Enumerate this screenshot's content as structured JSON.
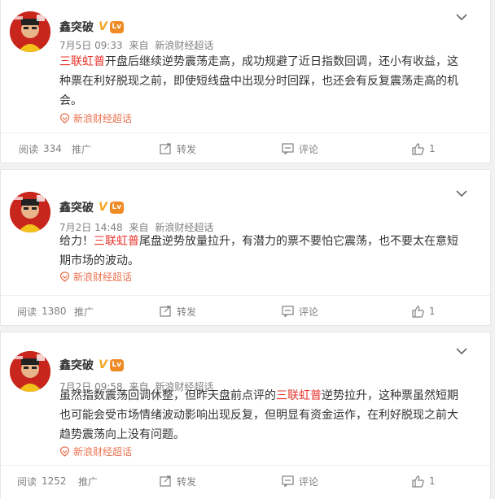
{
  "posts": [
    {
      "user": "鑫突破",
      "verified_badge": "V",
      "level_badge": "Lv",
      "time": "7月5日 09:33",
      "source_prefix": "来自",
      "source": "新浪财经超话",
      "text_before": "",
      "highlight": "三联虹普",
      "text_after": "开盘后继续逆势震荡走高，成功规避了近日指数回调，还小有收益，这种票在利好脱现之前，即使短线盘中出现分时回踩，也还会有反复震荡走高的机会。",
      "topic": "新浪财经超话",
      "read_label": "阅读",
      "read_count": "334",
      "promote": "推广",
      "forward": "转发",
      "comment": "评论",
      "likes": "1"
    },
    {
      "user": "鑫突破",
      "verified_badge": "V",
      "level_badge": "Lv",
      "time": "7月2日 14:48",
      "source_prefix": "来自",
      "source": "新浪财经超话",
      "text_before": "给力！",
      "highlight": "三联虹普",
      "text_after": "尾盘逆势放量拉升，有潜力的票不要怕它震荡，也不要太在意短期市场的波动。",
      "topic": "新浪财经超话",
      "read_label": "阅读",
      "read_count": "1380",
      "promote": "推广",
      "forward": "转发",
      "comment": "评论",
      "likes": "1"
    },
    {
      "user": "鑫突破",
      "verified_badge": "V",
      "level_badge": "Lv",
      "time": "7月2日 09:58",
      "source_prefix": "来自",
      "source": "新浪财经超话",
      "text_before": "虽然指数震荡回调休整，但昨天盘前点评的",
      "highlight": "三联虹普",
      "text_after": "逆势拉升，这种票虽然短期也可能会受市场情绪波动影响出现反复，但明显有资金运作，在利好脱现之前大趋势震荡向上没有问题。",
      "topic": "新浪财经超话",
      "read_label": "阅读",
      "read_count": "1252",
      "promote": "推广",
      "forward": "转发",
      "comment": "评论",
      "likes": "1"
    }
  ],
  "colors": {
    "highlight": "#e8352c",
    "topic": "#eb7350",
    "meta": "#808080",
    "avatar_bg": "#c8261c"
  },
  "icons": [
    "chevron-down-icon",
    "topic-icon",
    "forward-icon",
    "comment-icon",
    "like-icon"
  ]
}
